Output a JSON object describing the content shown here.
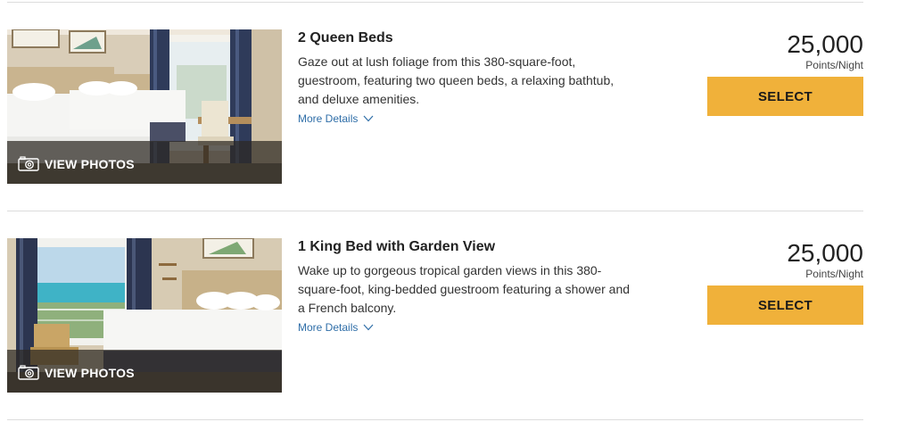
{
  "rooms": [
    {
      "title": "2 Queen Beds",
      "description": "Gaze out at lush foliage from this 380-square-foot, guestroom, featuring two queen beds, a relaxing bathtub, and deluxe amenities.",
      "more_details": "More Details",
      "view_photos": "VIEW PHOTOS",
      "points": "25,000",
      "unit": "Points/Night",
      "select_label": "SELECT"
    },
    {
      "title": "1 King Bed with Garden View",
      "description": "Wake up to gorgeous tropical garden views in this 380-square-foot, king-bedded guestroom featuring a shower and a French balcony.",
      "more_details": "More Details",
      "view_photos": "VIEW PHOTOS",
      "points": "25,000",
      "unit": "Points/Night",
      "select_label": "SELECT"
    }
  ],
  "colors": {
    "accent": "#f0b13a",
    "link": "#2f6ea8",
    "divider": "#dcdcdc"
  },
  "icons": {
    "camera": "camera-icon",
    "chevron": "chevron-down-icon"
  }
}
